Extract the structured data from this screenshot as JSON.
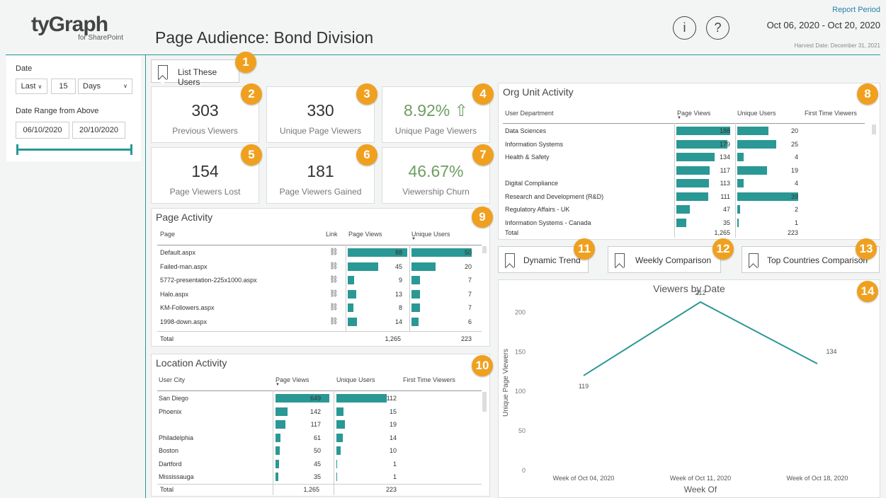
{
  "header": {
    "logo_main": "tyGraph",
    "logo_sub": "for SharePoint",
    "title": "Page Audience: Bond Division",
    "info_icon": "i",
    "help_icon": "?",
    "report_period_label": "Report Period",
    "date_range": "Oct 06, 2020 - Oct 20, 2020",
    "harvest_date": "Harvest Date: December 31, 2021"
  },
  "filters": {
    "date_label": "Date",
    "relative_option": "Last",
    "number": "15",
    "unit": "Days",
    "range_label": "Date Range from Above",
    "start_date": "06/10/2020",
    "end_date": "20/10/2020"
  },
  "list_users_button": "List These Users",
  "kpis": [
    {
      "value": "303",
      "label": "Previous Viewers",
      "badge": "2"
    },
    {
      "value": "330",
      "label": "Unique Page Viewers",
      "badge": "3"
    },
    {
      "value": "8.92% ⇧",
      "label": "Unique Page Viewers",
      "badge": "4"
    },
    {
      "value": "154",
      "label": "Page Viewers Lost",
      "badge": "5"
    },
    {
      "value": "181",
      "label": "Page Viewers Gained",
      "badge": "6"
    },
    {
      "value": "46.67%",
      "label": "Viewership Churn",
      "badge": "7"
    }
  ],
  "badges": {
    "list": "1",
    "org": "8",
    "page": "9",
    "loc": "10",
    "dyn": "11",
    "weekly": "12",
    "top": "13",
    "chart": "14"
  },
  "page_activity": {
    "title": "Page Activity",
    "headers": [
      "Page",
      "Link",
      "Page Views",
      "Unique Users"
    ],
    "rows": [
      {
        "page": "Default.aspx",
        "views": 88,
        "users": 50
      },
      {
        "page": "Failed-man.aspx",
        "views": 45,
        "users": 20
      },
      {
        "page": "5772-presentation-225x1000.aspx",
        "views": 9,
        "users": 7
      },
      {
        "page": "Halo.aspx",
        "views": 13,
        "users": 7
      },
      {
        "page": "KM-Followers.aspx",
        "views": 8,
        "users": 7
      },
      {
        "page": "1998-down.aspx",
        "views": 14,
        "users": 6
      }
    ],
    "total_label": "Total",
    "total_views": "1,265",
    "total_users": "223"
  },
  "location_activity": {
    "title": "Location Activity",
    "headers": [
      "User City",
      "Page Views",
      "Unique Users",
      "First Time Viewers"
    ],
    "rows": [
      {
        "city": "San Diego",
        "views": 649,
        "users": 112
      },
      {
        "city": "Phoenix",
        "views": 142,
        "users": 15
      },
      {
        "city": "",
        "views": 117,
        "users": 19
      },
      {
        "city": "Philadelphia",
        "views": 61,
        "users": 14
      },
      {
        "city": "Boston",
        "views": 50,
        "users": 10
      },
      {
        "city": "Dartford",
        "views": 45,
        "users": 1
      },
      {
        "city": "Mississauga",
        "views": 35,
        "users": 1
      }
    ],
    "total_label": "Total",
    "total_views": "1,265",
    "total_users": "223"
  },
  "org_activity": {
    "title": "Org Unit Activity",
    "headers": [
      "User Department",
      "Page Views",
      "Unique Users",
      "First Time Viewers"
    ],
    "rows": [
      {
        "dept": "Data Sciences",
        "views": 188,
        "users": 20
      },
      {
        "dept": "Information Systems",
        "views": 179,
        "users": 25
      },
      {
        "dept": "Health & Safety",
        "views": 134,
        "users": 4
      },
      {
        "dept": "",
        "views": 117,
        "users": 19
      },
      {
        "dept": "Digital Compliance",
        "views": 113,
        "users": 4
      },
      {
        "dept": "Research and Development (R&D)",
        "views": 111,
        "users": 39
      },
      {
        "dept": "Regulatory Affairs - UK",
        "views": 47,
        "users": 2
      },
      {
        "dept": "Information Systems - Canada",
        "views": 35,
        "users": 1
      }
    ],
    "total_label": "Total",
    "total_views": "1,265",
    "total_users": "223"
  },
  "buttons": {
    "dynamic": "Dynamic Trend",
    "weekly": "Weekly Comparison",
    "top": "Top Countries Comparison"
  },
  "chart_data": {
    "type": "line",
    "title": "Viewers by Date",
    "xlabel": "Week Of",
    "ylabel": "Unique Page Viewers",
    "categories": [
      "Week of Oct 04, 2020",
      "Week of Oct 11, 2020",
      "Week of Oct 18, 2020"
    ],
    "values": [
      119,
      212,
      134
    ],
    "ylim": [
      0,
      220
    ],
    "yticks": [
      "0",
      "50",
      "100",
      "150",
      "200"
    ],
    "color": "#2a9895"
  }
}
